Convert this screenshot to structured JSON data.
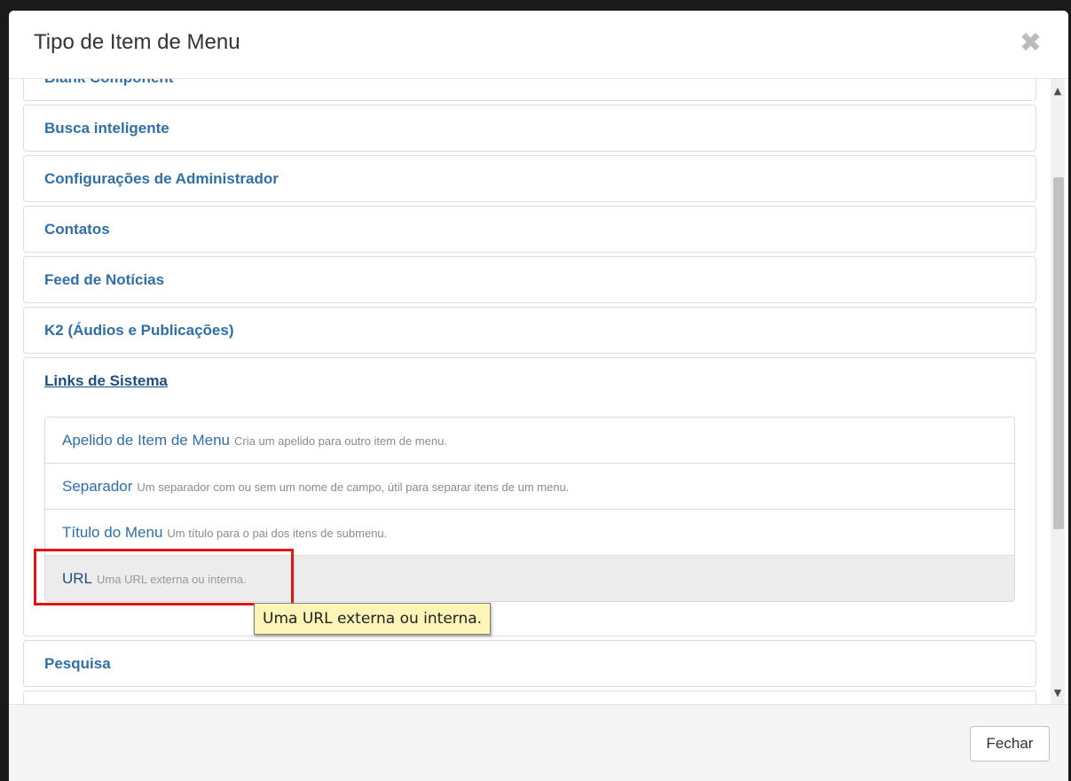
{
  "modal": {
    "title": "Tipo de Item de Menu",
    "close_glyph": "✖",
    "close_icon": "close-icon"
  },
  "accordion": {
    "partial_top": "Blank Component",
    "groups": [
      {
        "label": "Busca inteligente"
      },
      {
        "label": "Configurações de Administrador"
      },
      {
        "label": "Contatos"
      },
      {
        "label": "Feed de Notícias"
      },
      {
        "label": "K2 (Áudios e Publicações)"
      }
    ],
    "active_group": {
      "label": "Links de Sistema",
      "items": [
        {
          "title": "Apelido de Item de Menu",
          "description": "Cria um apelido para outro item de menu."
        },
        {
          "title": "Separador",
          "description": "Um separador com ou sem um nome de campo, útil para separar itens de um menu."
        },
        {
          "title": "Título do Menu",
          "description": "Um título para o pai dos itens de submenu."
        },
        {
          "title": "URL",
          "description": "Uma URL externa ou interna."
        }
      ]
    },
    "after_groups": [
      {
        "label": "Pesquisa"
      }
    ]
  },
  "tooltip": {
    "text": "Uma URL externa ou interna."
  },
  "scrollbar": {
    "up_glyph": "▲",
    "down_glyph": "▼"
  },
  "footer": {
    "close_label": "Fechar"
  },
  "colors": {
    "link": "#2f6fa8",
    "highlight": "#e21414",
    "tooltip_bg": "#fdf5b8"
  }
}
